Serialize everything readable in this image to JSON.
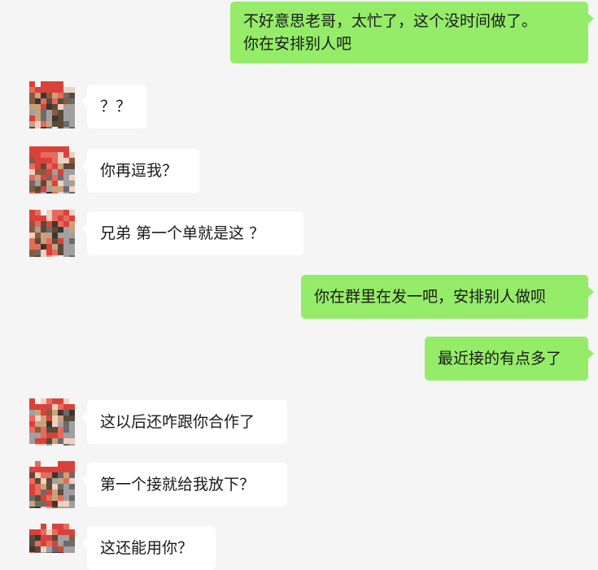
{
  "messages": [
    {
      "side": "out",
      "lines": [
        "不好意思老哥，太忙了，这个没时间做了。",
        "你在安排别人吧"
      ]
    },
    {
      "side": "in",
      "lines": [
        "？？"
      ]
    },
    {
      "side": "in",
      "lines": [
        "你再逗我？"
      ]
    },
    {
      "side": "in",
      "lines": [
        "兄弟  第一个单就是这 ？"
      ]
    },
    {
      "side": "out",
      "lines": [
        "你在群里在发一吧，安排别人做呗"
      ]
    },
    {
      "side": "out",
      "lines": [
        "最近接的有点多了"
      ]
    },
    {
      "side": "in",
      "lines": [
        "这以后还咋跟你合作了"
      ]
    },
    {
      "side": "in",
      "lines": [
        "第一个接就给我放下？"
      ]
    },
    {
      "side": "in",
      "lines": [
        "这还能用你？"
      ]
    }
  ],
  "avatar": {
    "icon": "pixelated-avatar-icon",
    "colors": [
      "#d9423a",
      "#8b5a3c",
      "#5a4a3a",
      "#c9a27a",
      "#e86a5a",
      "#a0a0a0",
      "#6b6b6b",
      "#f0d0c0",
      "#3d3530"
    ]
  }
}
